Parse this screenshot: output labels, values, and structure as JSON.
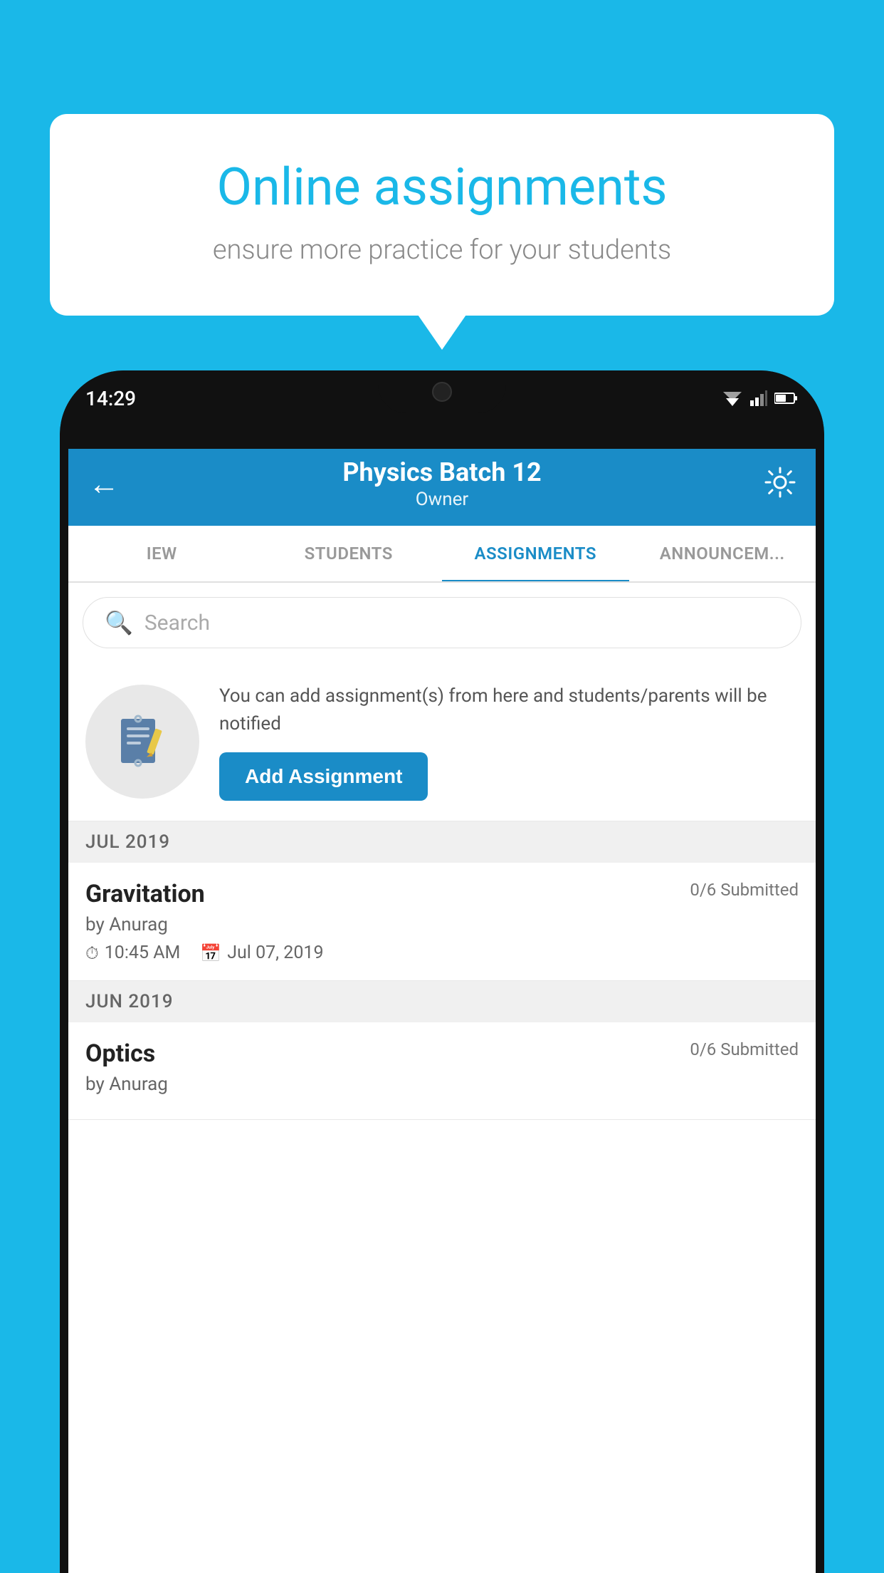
{
  "background_color": "#1ab8e8",
  "speech_bubble": {
    "title": "Online assignments",
    "subtitle": "ensure more practice for your students"
  },
  "status_bar": {
    "time": "14:29"
  },
  "app_header": {
    "title": "Physics Batch 12",
    "subtitle": "Owner"
  },
  "tabs": [
    {
      "label": "IEW",
      "active": false
    },
    {
      "label": "STUDENTS",
      "active": false
    },
    {
      "label": "ASSIGNMENTS",
      "active": true
    },
    {
      "label": "ANNOUNCEM...",
      "active": false
    }
  ],
  "search": {
    "placeholder": "Search"
  },
  "promo": {
    "text": "You can add assignment(s) from here and students/parents will be notified",
    "button_label": "Add Assignment"
  },
  "sections": [
    {
      "header": "JUL 2019",
      "assignments": [
        {
          "name": "Gravitation",
          "submitted": "0/6 Submitted",
          "by": "by Anurag",
          "time": "10:45 AM",
          "date": "Jul 07, 2019"
        }
      ]
    },
    {
      "header": "JUN 2019",
      "assignments": [
        {
          "name": "Optics",
          "submitted": "0/6 Submitted",
          "by": "by Anurag",
          "time": "",
          "date": ""
        }
      ]
    }
  ]
}
